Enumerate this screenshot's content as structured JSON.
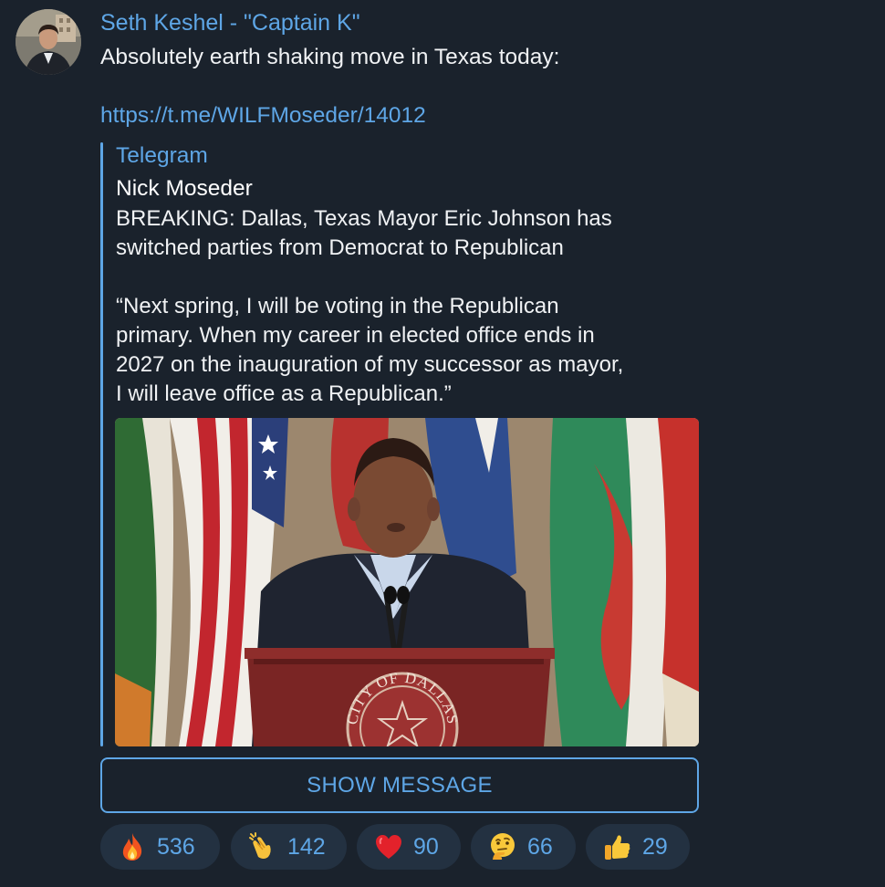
{
  "message": {
    "author": "Seth Keshel - \"Captain K\"",
    "text": "Absolutely earth shaking move in Texas today:",
    "link": "https://t.me/WILFMoseder/14012"
  },
  "preview": {
    "site_name": "Telegram",
    "title": "Nick Moseder",
    "description_lines": [
      "BREAKING: Dallas, Texas Mayor Eric Johnson has",
      "switched parties from Democrat to Republican",
      "",
      "“Next spring, I will be voting in the Republican",
      "primary. When my career in elected office ends in",
      "2027 on the inauguration of my successor as mayor,",
      "I will leave office as a Republican.”"
    ],
    "image": {
      "podium_seal_text": "CITY OF DALLAS"
    }
  },
  "show_message_label": "SHOW MESSAGE",
  "reactions": [
    {
      "icon": "fire-icon",
      "count": "536"
    },
    {
      "icon": "clapping-hands-icon",
      "count": "142"
    },
    {
      "icon": "red-heart-icon",
      "count": "90"
    },
    {
      "icon": "thinking-face-icon",
      "count": "66"
    },
    {
      "icon": "thumbs-up-icon",
      "count": "29"
    }
  ],
  "colors": {
    "background": "#1a222c",
    "accent": "#5ea6e6",
    "text": "#f0f2f4",
    "reaction_bg": "#233141"
  }
}
